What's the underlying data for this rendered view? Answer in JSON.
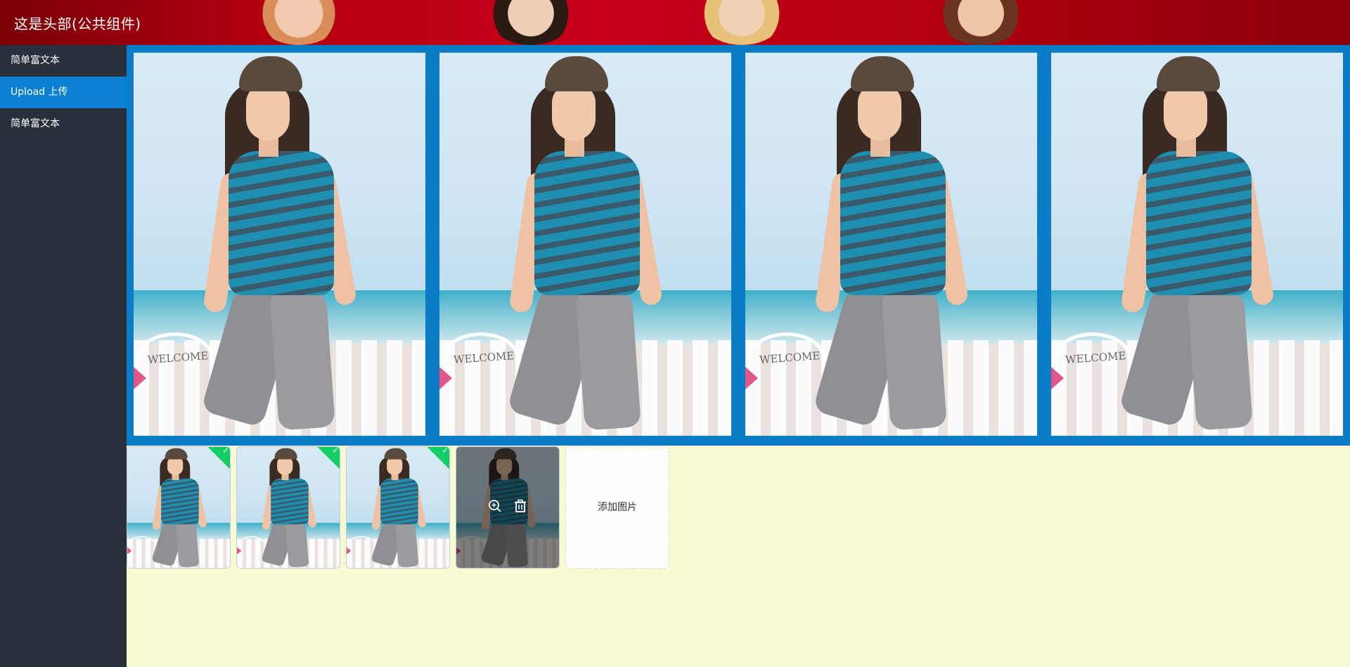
{
  "header": {
    "title": "这是头部(公共组件)"
  },
  "sidebar": {
    "items": [
      {
        "label": "简单富文本",
        "active": false
      },
      {
        "label": "Upload 上传",
        "active": true
      },
      {
        "label": "简单富文本",
        "active": false
      }
    ]
  },
  "gallery": {
    "photos": [
      {
        "sign_text": "WELCOME"
      },
      {
        "sign_text": "WELCOME"
      },
      {
        "sign_text": "WELCOME"
      },
      {
        "sign_text": "WELCOME"
      }
    ]
  },
  "upload": {
    "files": [
      {
        "status": "success",
        "icon": "check-icon"
      },
      {
        "status": "success",
        "icon": "check-icon"
      },
      {
        "status": "success",
        "icon": "check-icon"
      },
      {
        "status": "hover",
        "actions": [
          "zoom-in-icon",
          "delete-icon"
        ]
      }
    ],
    "add_label": "添加图片"
  },
  "colors": {
    "header_bg": "#b3000f",
    "sidebar_bg": "#28313b",
    "active_item": "#0a80d0",
    "gallery_bg": "#0a7cc8",
    "content_bg": "#fafad2",
    "success": "#13ce66"
  }
}
